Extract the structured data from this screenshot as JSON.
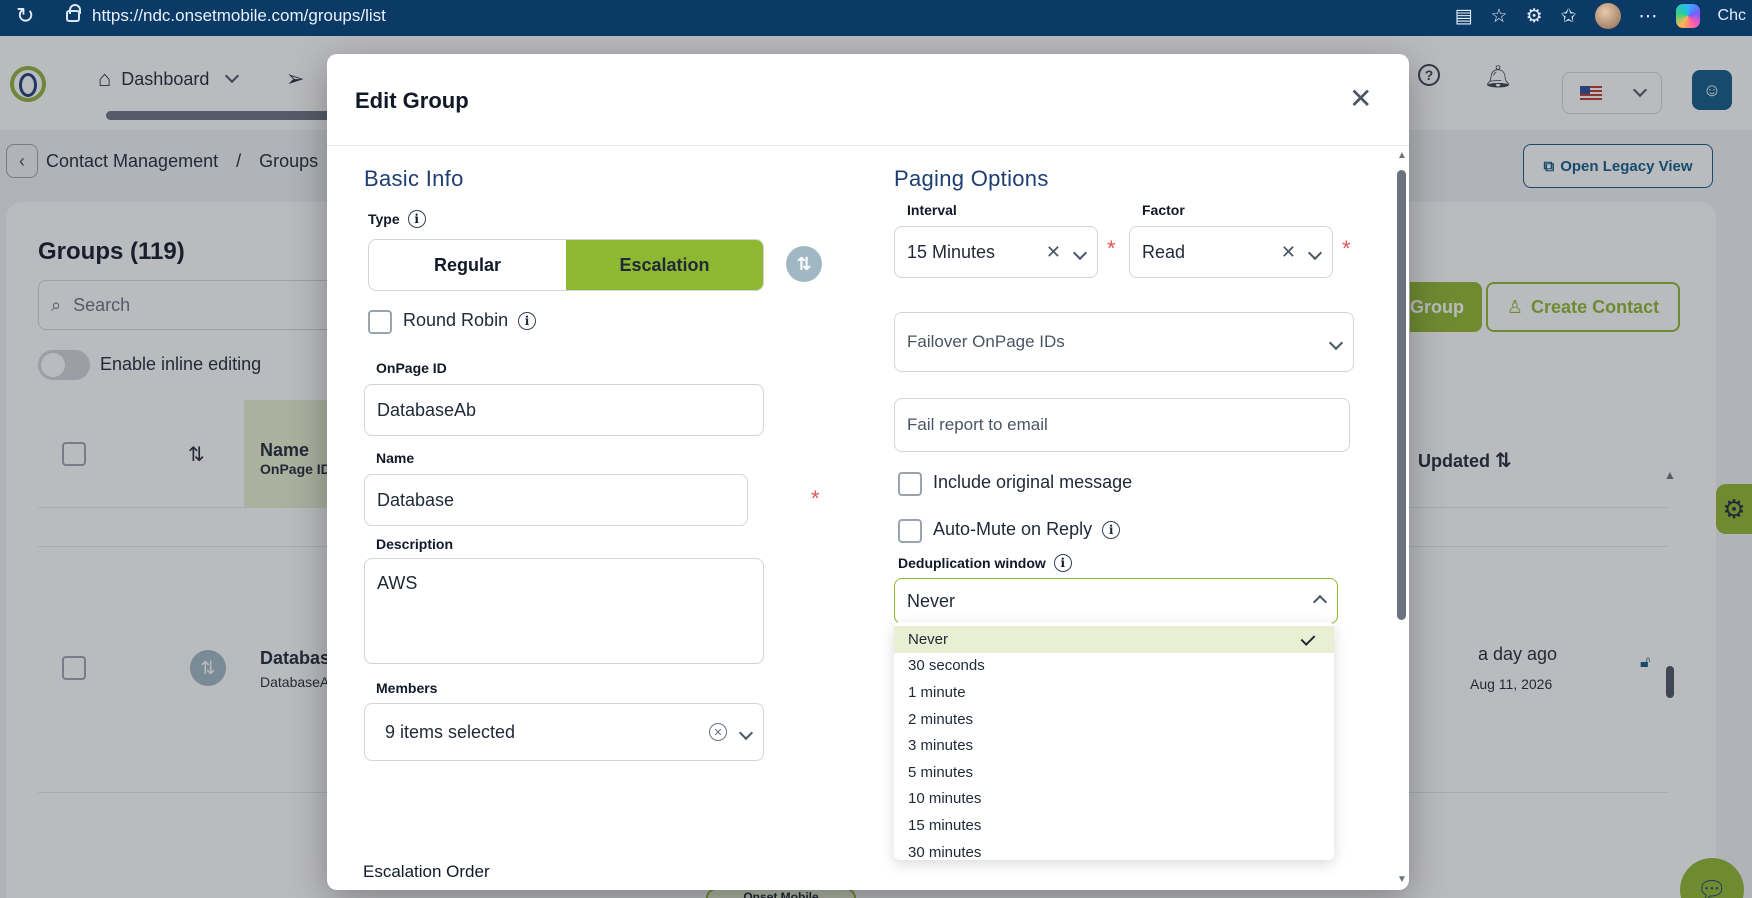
{
  "browser": {
    "url": "https://ndc.onsetmobile.com/groups/list",
    "profile_text": "Chc"
  },
  "header": {
    "nav": [
      {
        "label": "Dashboard",
        "icon": "home-icon"
      },
      {
        "label": "",
        "icon": "send-icon"
      }
    ]
  },
  "breadcrumb": {
    "items": [
      "Contact Management",
      "/",
      "Groups"
    ]
  },
  "background": {
    "legacy_button": "Open Legacy View",
    "title": "Groups (119)",
    "search_placeholder": "Search",
    "inline_editing_label": "Enable inline editing",
    "create_group_label": "Group",
    "create_contact_label": "Create Contact",
    "columns": {
      "name": "Name",
      "name_sub": "OnPage ID",
      "updated": "Updated"
    },
    "row": {
      "name": "Database",
      "sub": "DatabaseA",
      "updated": "a day ago",
      "date": "Aug 11, 2026"
    },
    "chip_label": "Onset Mobile"
  },
  "modal": {
    "title": "Edit Group",
    "basic_info": {
      "section_title": "Basic Info",
      "type_label": "Type",
      "type_options": [
        "Regular",
        "Escalation"
      ],
      "type_selected": "Escalation",
      "round_robin_label": "Round Robin",
      "onpage_id_label": "OnPage ID",
      "onpage_id_value": "DatabaseAb",
      "name_label": "Name",
      "name_value": "Database",
      "description_label": "Description",
      "description_value": "AWS",
      "members_label": "Members",
      "members_value": "9 items selected",
      "escalation_order_label": "Escalation Order"
    },
    "paging": {
      "section_title": "Paging Options",
      "interval_label": "Interval",
      "interval_value": "15 Minutes",
      "factor_label": "Factor",
      "factor_value": "Read",
      "failover_placeholder": "Failover OnPage IDs",
      "fail_report_placeholder": "Fail report to email",
      "include_original_label": "Include original message",
      "auto_mute_label": "Auto-Mute on Reply",
      "dedup_label": "Deduplication window",
      "dedup_value": "Never",
      "dedup_options": [
        "Never",
        "30 seconds",
        "1 minute",
        "2 minutes",
        "3 minutes",
        "5 minutes",
        "10 minutes",
        "15 minutes",
        "30 minutes"
      ]
    }
  }
}
